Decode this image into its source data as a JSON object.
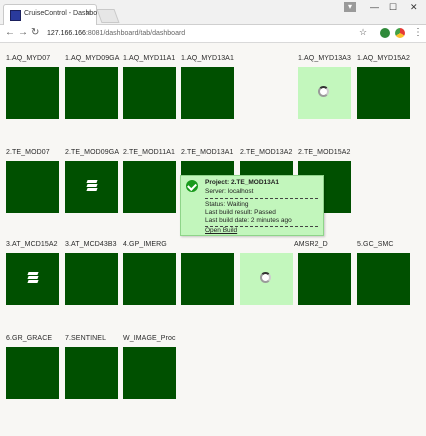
{
  "browser": {
    "tab_title": "CruiseControl - Dashbo",
    "url_host": "127.166.166",
    "url_path": ":8081/dashboard/tab/dashboard"
  },
  "tiles": [
    {
      "label": "1.AQ_MYD07",
      "status": "passed"
    },
    {
      "label": "1.AQ_MYD09GA",
      "status": "passed"
    },
    {
      "label": "1.AQ_MYD11A1",
      "status": "passed"
    },
    {
      "label": "1.AQ_MYD13A1",
      "status": "passed"
    },
    {
      "label": "1.AQ_MYD13A3",
      "status": "building"
    },
    {
      "label": "1.AQ_MYD15A2",
      "status": "passed"
    },
    {
      "label": "2.TE_MOD07",
      "status": "passed"
    },
    {
      "label": "2.TE_MOD09GA",
      "status": "passed-stack"
    },
    {
      "label": "2.TE_MOD11A1",
      "status": "passed"
    },
    {
      "label": "2.TE_MOD13A1",
      "status": "passed"
    },
    {
      "label": "2.TE_MOD13A2",
      "status": "passed"
    },
    {
      "label": "2.TE_MOD15A2",
      "status": "passed"
    },
    {
      "label": "3.AT_MCD15A2",
      "status": "passed-stack"
    },
    {
      "label": "3.AT_MCD43B3",
      "status": "passed"
    },
    {
      "label": "4.GP_IMERG",
      "status": "passed"
    },
    {
      "label": "",
      "status": "passed"
    },
    {
      "label": "AMSR2_D",
      "status": "passed"
    },
    {
      "label": "5.GC_SMC",
      "status": "passed"
    },
    {
      "label": "6.GR_GRACE",
      "status": "passed"
    },
    {
      "label": "7.SENTINEL",
      "status": "passed"
    },
    {
      "label": "W_IMAGE_Proc",
      "status": "passed"
    }
  ],
  "popup": {
    "project": "Project: 2.TE_MOD13A1",
    "server": "Server: localhost",
    "status": "Status: Waiting",
    "last_result": "Last build result: Passed",
    "last_date": "Last build date: 2 minutes ago",
    "link": "Open Build"
  }
}
